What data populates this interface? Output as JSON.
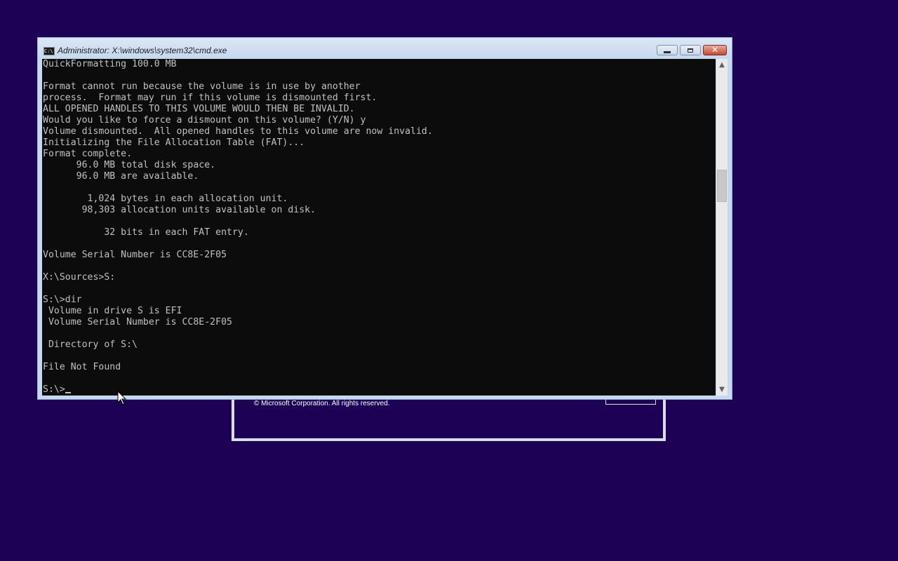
{
  "setup_dialog": {
    "copyright": "© Microsoft Corporation. All rights reserved."
  },
  "window": {
    "title": "Administrator: X:\\windows\\system32\\cmd.exe",
    "icon": "cmd-icon",
    "icon_text": "C:\\"
  },
  "console": {
    "lines": [
      "QuickFormatting 100.0 MB",
      "",
      "Format cannot run because the volume is in use by another",
      "process.  Format may run if this volume is dismounted first.",
      "ALL OPENED HANDLES TO THIS VOLUME WOULD THEN BE INVALID.",
      "Would you like to force a dismount on this volume? (Y/N) y",
      "Volume dismounted.  All opened handles to this volume are now invalid.",
      "Initializing the File Allocation Table (FAT)...",
      "Format complete.",
      "      96.0 MB total disk space.",
      "      96.0 MB are available.",
      "",
      "        1,024 bytes in each allocation unit.",
      "       98,303 allocation units available on disk.",
      "",
      "           32 bits in each FAT entry.",
      "",
      "Volume Serial Number is CC8E-2F05",
      "",
      "X:\\Sources>S:",
      "",
      "S:\\>dir",
      " Volume in drive S is EFI",
      " Volume Serial Number is CC8E-2F05",
      "",
      " Directory of S:\\",
      "",
      "File Not Found",
      ""
    ],
    "prompt": "S:\\>"
  },
  "colors": {
    "desktop_background": "#1d0155",
    "console_background": "#0c0c0c",
    "console_text": "#c0c0c0",
    "titlebar": "#c6d9ef",
    "close_button": "#c64a32"
  }
}
